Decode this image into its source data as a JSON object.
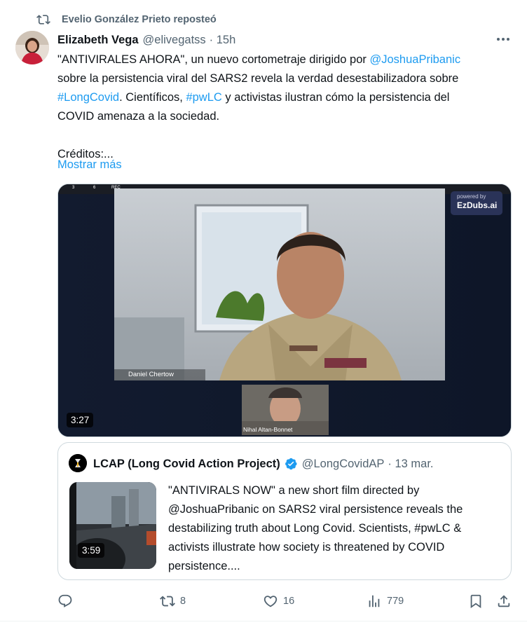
{
  "repost": {
    "text": "Evelio González Prieto reposteó"
  },
  "author": {
    "name": "Elizabeth Vega",
    "handle": "@elivegatss",
    "time": "· 15h"
  },
  "post": {
    "line1_a": "\"ANTIVIRALES AHORA\", un nuevo cortometraje dirigido por ",
    "line1_link": "@JoshuaPribanic",
    "line2": "sobre la persistencia viral del SARS2 revela la verdad desestabilizadora sobre",
    "line3_link1": "#LongCovid",
    "line3_a": ".  Científicos, ",
    "line3_link2": "#pwLC",
    "line3_b": " y activistas ilustran cómo la persistencia del",
    "line4": "COVID amenaza a la sociedad.",
    "line5": "Créditos:...",
    "show_more": "Mostrar más"
  },
  "video": {
    "duration": "3:27",
    "badge_top": "powered by",
    "badge_brand": "EzDubs.ai",
    "participant_main": "Daniel  Chertow",
    "participant_small": "Nihal  Altan-Bonnet",
    "rec_label": "REC",
    "status_count1": "3",
    "status_count2": "6"
  },
  "quote": {
    "name": "LCAP (Long Covid Action Project)",
    "handle": "@LongCovidAP",
    "time": "· 13 mar.",
    "duration": "3:59",
    "lines": [
      "\"ANTIVIRALS NOW\" a new short film directed by",
      "@JoshuaPribanic on SARS2 viral persistence reveals the",
      "destabilizing truth about Long Covid. Scientists, #pwLC &",
      "activists illustrate how society is threatened by COVID",
      "persistence...."
    ]
  },
  "actions": {
    "reposts": "8",
    "likes": "16",
    "views": "779"
  },
  "colors": {
    "link": "#1d9bf0",
    "muted": "#536471",
    "text": "#0f1419",
    "border": "#cfd9de"
  }
}
